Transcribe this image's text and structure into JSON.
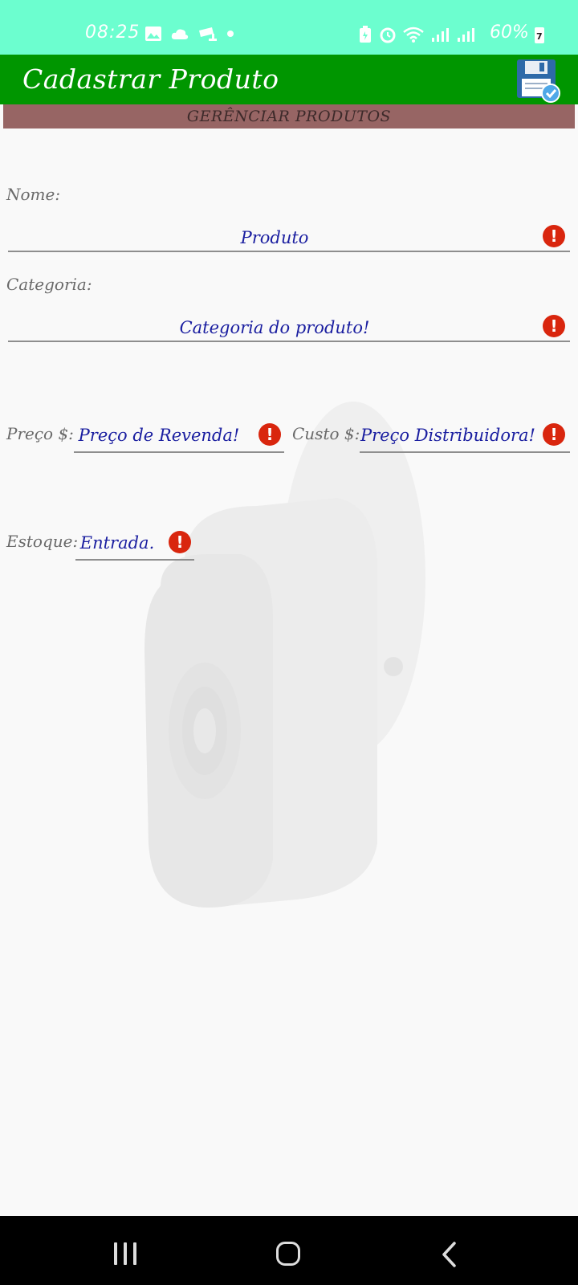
{
  "status_bar": {
    "time": "08:25",
    "battery": "60%",
    "battery_badge": "7",
    "icons": [
      "image-icon",
      "cloud-icon",
      "camera-icon",
      "dot-icon",
      "battery-saver-icon",
      "alarm-icon",
      "wifi-icon",
      "signal-icon",
      "signal-icon",
      "battery-icon"
    ]
  },
  "app_bar": {
    "title": "Cadastrar Produto",
    "action_icon": "save-icon"
  },
  "section": {
    "title": "GERÊNCIAR PRODUTOS"
  },
  "form": {
    "nome": {
      "label": "Nome:",
      "value": "Produto"
    },
    "categoria": {
      "label": "Categoria:",
      "value": "Categoria do produto!"
    },
    "preco": {
      "label": "Preço $:",
      "value": "Preço de Revenda!"
    },
    "custo": {
      "label": "Custo $:",
      "value": "Preço Distribuidora!"
    },
    "estoque": {
      "label": "Estoque:",
      "value": "Entrada."
    },
    "error_glyph": "!"
  },
  "colors": {
    "status_bar": "#6cfecf",
    "app_bar": "#009600",
    "section_bar": "#976564",
    "value_text": "#1a1ea0",
    "error": "#d9260e"
  },
  "nav_bar": {
    "icons": [
      "recents-icon",
      "home-icon",
      "back-icon"
    ]
  }
}
